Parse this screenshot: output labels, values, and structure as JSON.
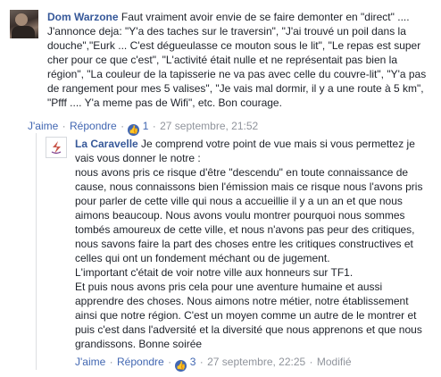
{
  "comments": [
    {
      "author": "Dom Warzone",
      "text": " Faut vraiment avoir envie de se faire demonter en \"direct\" .... J'annonce deja: \"Y'a des taches sur le traversin\", \"J'ai trouvé un poil dans la douche\",\"Eurk ... C'est dégueulasse ce mouton sous le lit\", \"Le repas est super cher pour ce que c'est\", \"L'activité était nulle et ne représentait pas bien la région\", \"La couleur de la tapisserie ne va pas avec celle du couvre-lit\", \"Y'a pas de rangement pour mes 5 valises\", \"Je vais mal dormir, il y a une route à 5 km\", \"Pfff .... Y'a meme pas de Wifi\", etc. Bon courage.",
      "like_label": "J'aime",
      "reply_label": "Répondre",
      "reaction_icon": "thumbs-up-icon",
      "reaction_count": "1",
      "timestamp": "27 septembre, 21:52",
      "edited_label": ""
    },
    {
      "author": "La Caravelle",
      "text": " Je comprend votre point de vue mais si vous permettez je vais vous donner le notre :\nnous avons pris ce risque d'être \"descendu\" en toute connaissance de cause, nous connaissons bien l'émission mais ce risque nous l'avons pris pour parler de cette ville qui nous a accueillie il y a un an et que nous aimons beaucoup. Nous avons voulu montrer pourquoi nous sommes tombés amoureux de cette ville, et nous n'avons pas peur des critiques, nous savons faire la part des choses entre les critiques constructives et celles qui ont un fondement méchant ou de jugement.\nL'important c'était de voir notre ville aux honneurs sur TF1.\nEt puis nous avons pris cela pour une aventure humaine et aussi apprendre des choses. Nous aimons notre métier, notre établissement ainsi que notre région. C'est un moyen comme un autre de le montrer et puis c'est dans l'adversité et la diversité que nous apprenons et que nous grandissons. Bonne soirée",
      "like_label": "J'aime",
      "reply_label": "Répondre",
      "reaction_icon": "thumbs-up-icon",
      "reaction_count": "3",
      "timestamp": "27 septembre, 22:25",
      "edited_label": "Modifié"
    }
  ],
  "separator": "·",
  "colors": {
    "author": "#365899",
    "link": "#4267b2",
    "meta": "#90949c",
    "text": "#1d2129"
  }
}
